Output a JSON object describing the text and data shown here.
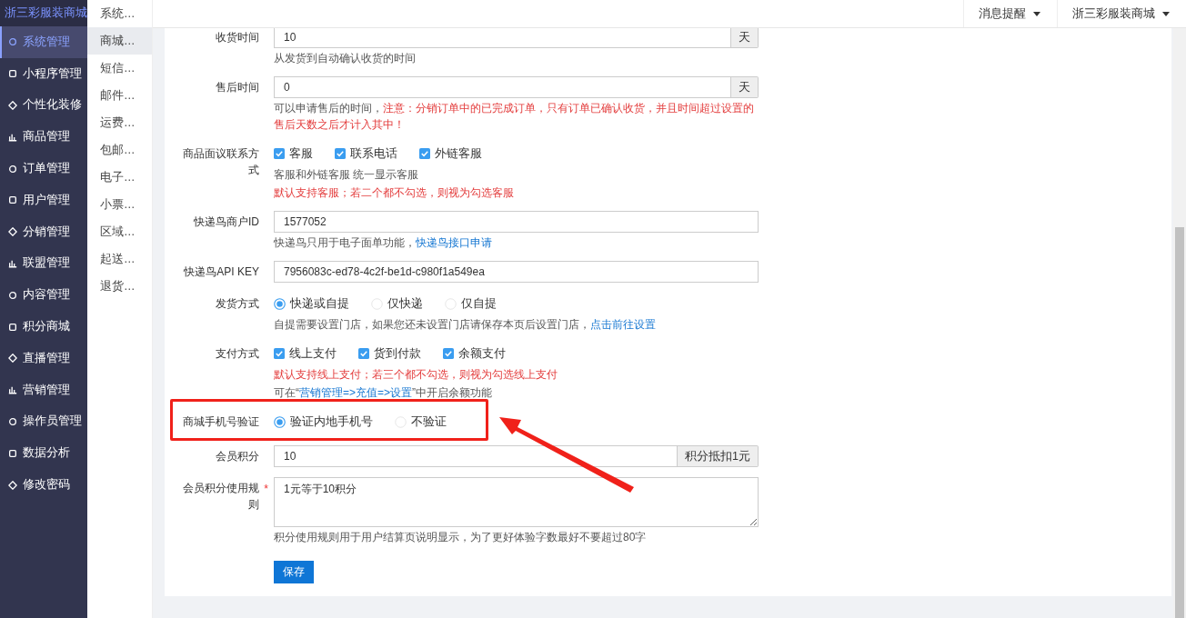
{
  "sidebar": {
    "brand": "浙三彩服装商城",
    "items": [
      {
        "label": "系统管理",
        "selected": true
      },
      {
        "label": "小程序管理",
        "selected": false
      },
      {
        "label": "个性化装修",
        "selected": false
      },
      {
        "label": "商品管理",
        "selected": false
      },
      {
        "label": "订单管理",
        "selected": false
      },
      {
        "label": "用户管理",
        "selected": false
      },
      {
        "label": "分销管理",
        "selected": false
      },
      {
        "label": "联盟管理",
        "selected": false
      },
      {
        "label": "内容管理",
        "selected": false
      },
      {
        "label": "积分商城",
        "selected": false
      },
      {
        "label": "直播管理",
        "selected": false
      },
      {
        "label": "营销管理",
        "selected": false
      },
      {
        "label": "操作员管理",
        "selected": false
      },
      {
        "label": "数据分析",
        "selected": false
      },
      {
        "label": "修改密码",
        "selected": false
      }
    ]
  },
  "submenu": {
    "items": [
      {
        "label": "系统…",
        "selected": false
      },
      {
        "label": "商城…",
        "selected": true
      },
      {
        "label": "短信…",
        "selected": false
      },
      {
        "label": "邮件…",
        "selected": false
      },
      {
        "label": "运费…",
        "selected": false
      },
      {
        "label": "包邮…",
        "selected": false
      },
      {
        "label": "电子…",
        "selected": false
      },
      {
        "label": "小票…",
        "selected": false
      },
      {
        "label": "区域…",
        "selected": false
      },
      {
        "label": "起送…",
        "selected": false
      },
      {
        "label": "退货…",
        "selected": false
      }
    ]
  },
  "topbar": {
    "menus": [
      {
        "label": "消息提醒"
      },
      {
        "label": "浙三彩服装商城"
      }
    ]
  },
  "form": {
    "fields": [
      {
        "kind": "input",
        "label": "收货时间",
        "value": "10",
        "addon": "天",
        "hints": [
          {
            "parts": [
              {
                "kind": "text",
                "text": "从发货到自动确认收货的时间"
              }
            ]
          }
        ]
      },
      {
        "kind": "input",
        "label": "售后时间",
        "value": "0",
        "addon": "天",
        "hints": [
          {
            "parts": [
              {
                "kind": "text",
                "text": "可以申请售后的时间，"
              },
              {
                "kind": "warning",
                "text": "注意：分销订单中的已完成订单，只有订单已确认收货，并且时间超过设置的售后天数之后才计入其中！"
              }
            ]
          }
        ]
      },
      {
        "kind": "checkboxes",
        "label": "商品面议联系方式",
        "options": [
          {
            "label": "客服",
            "checked": true
          },
          {
            "label": "联系电话",
            "checked": true
          },
          {
            "label": "外链客服",
            "checked": true
          }
        ],
        "hints": [
          {
            "parts": [
              {
                "kind": "text",
                "text": "客服和外链客服 统一显示客服"
              }
            ]
          },
          {
            "parts": [
              {
                "kind": "warning",
                "text": "默认支持客服；若二个都不勾选，则视为勾选客服"
              }
            ]
          }
        ]
      },
      {
        "kind": "input",
        "label": "快递鸟商户ID",
        "value": "1577052",
        "hints": [
          {
            "parts": [
              {
                "kind": "text",
                "text": "快递鸟只用于电子面单功能，"
              },
              {
                "kind": "link",
                "text": "快递鸟接口申请"
              }
            ]
          }
        ]
      },
      {
        "kind": "input",
        "label": "快递鸟API KEY",
        "value": "7956083c-ed78-4c2f-be1d-c980f1a549ea"
      },
      {
        "kind": "radios",
        "label": "发货方式",
        "options": [
          {
            "label": "快递或自提",
            "selected": true
          },
          {
            "label": "仅快递",
            "selected": false
          },
          {
            "label": "仅自提",
            "selected": false
          }
        ],
        "hints": [
          {
            "parts": [
              {
                "kind": "text",
                "text": "自提需要设置门店，如果您还未设置门店请保存本页后设置门店，"
              },
              {
                "kind": "link",
                "text": "点击前往设置"
              }
            ]
          }
        ]
      },
      {
        "kind": "checkboxes",
        "label": "支付方式",
        "options": [
          {
            "label": "线上支付",
            "checked": true
          },
          {
            "label": "货到付款",
            "checked": true
          },
          {
            "label": "余额支付",
            "checked": true
          }
        ],
        "hints": [
          {
            "parts": [
              {
                "kind": "warning",
                "text": "默认支持线上支付；若三个都不勾选，则视为勾选线上支付"
              }
            ]
          },
          {
            "parts": [
              {
                "kind": "text",
                "text": "可在“"
              },
              {
                "kind": "link",
                "text": "营销管理=>充值=>设置"
              },
              {
                "kind": "text",
                "text": "”中开启余额功能"
              }
            ]
          }
        ]
      },
      {
        "kind": "radios",
        "label": "商城手机号验证",
        "highlighted": true,
        "options": [
          {
            "label": "验证内地手机号",
            "selected": true
          },
          {
            "label": "不验证",
            "selected": false
          }
        ]
      },
      {
        "kind": "input",
        "label": "会员积分",
        "value": "10",
        "addon": "积分抵扣1元"
      },
      {
        "kind": "textarea",
        "label": "会员积分使用规则",
        "required_mark": "*",
        "value": "1元等于10积分",
        "hints": [
          {
            "parts": [
              {
                "kind": "text",
                "text": "积分使用规则用于用户结算页说明显示，为了更好体验字数最好不要超过80字"
              }
            ]
          }
        ]
      }
    ],
    "save_button": "保存"
  }
}
